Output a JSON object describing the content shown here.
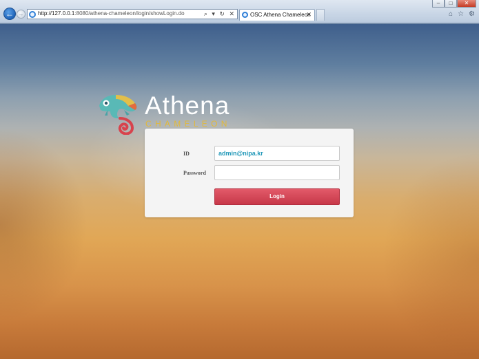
{
  "browser": {
    "url_prefix": "http://",
    "url_host": "127.0.0.1",
    "url_rest": ":8080/athena-chameleon/login/showLogin.do",
    "tab_title": "OSC Athena Chameleon",
    "tab_close": "✕",
    "address_tools": "⌕ ▾ ↻ ✕",
    "window_buttons": [
      "–",
      "□",
      "✕"
    ],
    "toolbar_icons": [
      "⌂",
      "☆",
      "⚙"
    ]
  },
  "logo": {
    "title": "Athena",
    "subtitle": "CHAMELEON",
    "colors": {
      "title": "#ffffff",
      "subtitle": "#e2b93a",
      "mark_teal": "#56b8b6",
      "mark_red": "#d8434d"
    }
  },
  "login": {
    "id_label": "ID",
    "id_value": "admin@nipa.kr",
    "password_label": "Password",
    "password_value": "",
    "button_label": "Login",
    "button_color": "#d9475a"
  }
}
